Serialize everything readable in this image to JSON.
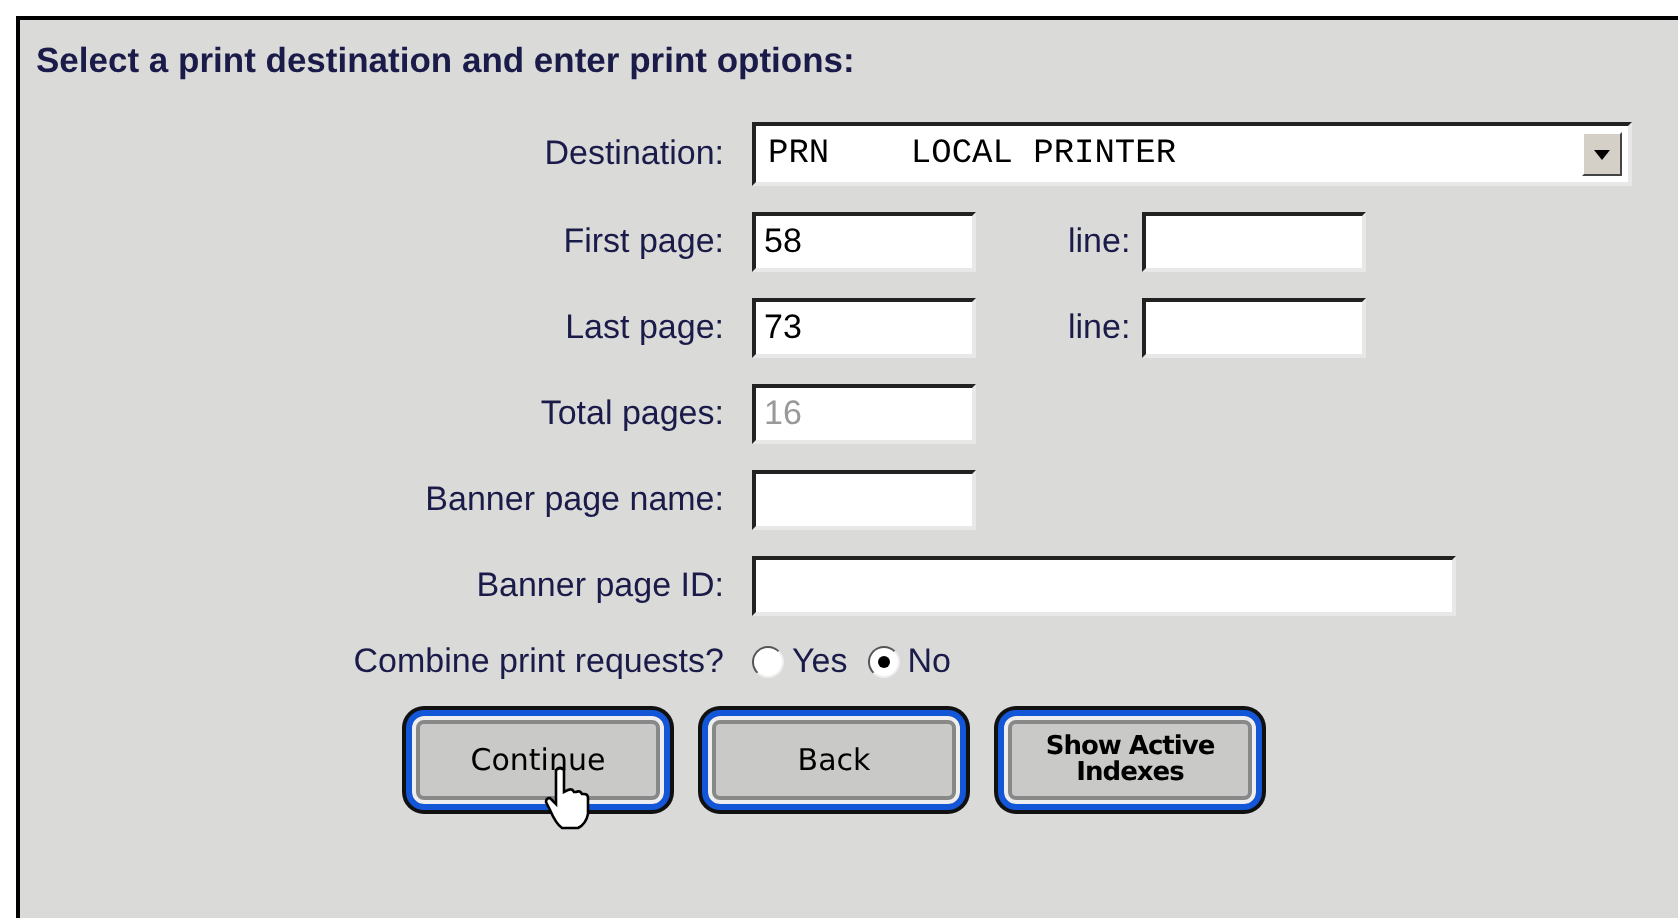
{
  "heading": "Select a print destination and enter print options:",
  "rows": [
    {
      "label": "Destination:",
      "field": {
        "kind": "select",
        "value": "PRN    LOCAL PRINTER"
      }
    },
    {
      "label": "First page:",
      "field": {
        "kind": "short",
        "value": "58"
      },
      "extra": {
        "label": "line:"
      }
    },
    {
      "label": "Last page:",
      "field": {
        "kind": "short",
        "value": "73"
      },
      "extra": {
        "label": "line:"
      }
    },
    {
      "label": "Total pages:",
      "field": {
        "kind": "short",
        "value": "16",
        "disabled": true
      }
    },
    {
      "label": "Banner page name:",
      "field": {
        "kind": "short"
      }
    },
    {
      "label": "Banner page ID:",
      "field": {
        "kind": "long"
      }
    }
  ],
  "combine": {
    "label": "Combine print requests?",
    "options": [
      {
        "label": "Yes",
        "selected": false
      },
      {
        "label": "No",
        "selected": true
      }
    ]
  },
  "buttons": [
    {
      "label": "Continue"
    },
    {
      "label": "Back"
    },
    {
      "label": "Show Active Indexes",
      "kind": "small"
    }
  ]
}
